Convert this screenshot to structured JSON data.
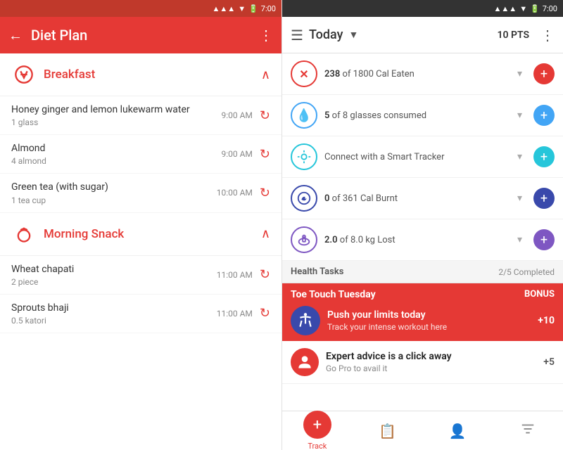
{
  "left": {
    "statusbar": {
      "time": "7:00"
    },
    "toolbar": {
      "title": "Diet Plan",
      "back_icon": "←",
      "more_icon": "⋮"
    },
    "sections": [
      {
        "id": "breakfast",
        "label": "Breakfast",
        "icon": "🍽",
        "items": [
          {
            "name": "Honey ginger and lemon lukewarm water",
            "qty": "1 glass",
            "time": "9:00 AM"
          },
          {
            "name": "Almond",
            "qty": "4 almond",
            "time": "9:00 AM"
          },
          {
            "name": "Green tea (with sugar)",
            "qty": "1 tea cup",
            "time": "10:00 AM"
          }
        ]
      },
      {
        "id": "morning-snack",
        "label": "Morning Snack",
        "icon": "🥗",
        "items": [
          {
            "name": "Wheat chapati",
            "qty": "2 piece",
            "time": "11:00 AM"
          },
          {
            "name": "Sprouts bhaji",
            "qty": "0.5 katori",
            "time": "11:00 AM"
          }
        ]
      }
    ]
  },
  "right": {
    "statusbar": {
      "time": "7:00"
    },
    "toolbar": {
      "today_label": "Today",
      "pts_label": "10 PTS",
      "dropdown_icon": "▼",
      "hamburger_icon": "☰",
      "more_icon": "⋮"
    },
    "stats": [
      {
        "id": "calories",
        "icon": "✕",
        "icon_class": "calories",
        "text_prefix": "",
        "value": "238",
        "text": "of 1800 Cal Eaten",
        "btn_class": "red",
        "btn_icon": "+"
      },
      {
        "id": "water",
        "icon": "💧",
        "icon_class": "water",
        "value": "5",
        "text": "of 8 glasses consumed",
        "btn_class": "blue",
        "btn_icon": "+"
      },
      {
        "id": "tracker",
        "icon": "⚙",
        "icon_class": "tracker",
        "value": "",
        "text": "Connect with a Smart Tracker",
        "btn_class": "teal",
        "btn_icon": "+"
      },
      {
        "id": "burnt",
        "icon": "🏃",
        "icon_class": "burnt",
        "value": "0",
        "text": "of 361 Cal Burnt",
        "btn_class": "indigo",
        "btn_icon": "+"
      },
      {
        "id": "weight",
        "icon": "⚖",
        "icon_class": "weight",
        "value": "2.0",
        "text": "of 8.0 kg Lost",
        "btn_class": "purple",
        "btn_icon": "+"
      }
    ],
    "health_tasks": {
      "label": "Health Tasks",
      "count": "2/5 Completed"
    },
    "toe_touch": {
      "title": "Toe Touch Tuesday",
      "bonus": "BONUS",
      "push_title": "Push your limits today",
      "push_sub": "Track your intense workout here",
      "push_pts": "+10"
    },
    "expert_task": {
      "title": "Expert advice is a click away",
      "sub": "Go Pro to avail it",
      "pts": "+5"
    },
    "bottom_nav": [
      {
        "id": "track",
        "icon": "+",
        "label": "Track",
        "active": true,
        "is_circle": true
      },
      {
        "id": "diary",
        "icon": "📋",
        "label": "",
        "active": false,
        "is_circle": false
      },
      {
        "id": "profile",
        "icon": "👤",
        "label": "",
        "active": false,
        "is_circle": false
      },
      {
        "id": "filter",
        "icon": "☰",
        "label": "",
        "active": false,
        "is_circle": false
      }
    ]
  }
}
